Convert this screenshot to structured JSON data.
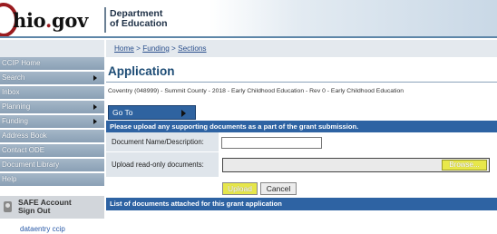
{
  "header": {
    "logo_prefix": "O",
    "logo_main": "hio",
    "logo_dot": ".",
    "logo_suffix": "gov",
    "department_line1": "Department",
    "department_line2": "of Education"
  },
  "breadcrumb": {
    "home": "Home",
    "sep1": " > ",
    "funding": "Funding",
    "sep2": " > ",
    "sections": "Sections"
  },
  "sidebar": {
    "items": [
      {
        "label": "CCIP Home",
        "has_arrow": false
      },
      {
        "label": "Search",
        "has_arrow": true
      },
      {
        "label": "Inbox",
        "has_arrow": false
      },
      {
        "label": "Planning",
        "has_arrow": true
      },
      {
        "label": "Funding",
        "has_arrow": true
      },
      {
        "label": "Address Book",
        "has_arrow": false
      },
      {
        "label": "Contact ODE",
        "has_arrow": false
      },
      {
        "label": "Document Library",
        "has_arrow": false
      },
      {
        "label": "Help",
        "has_arrow": false
      }
    ],
    "safe_line1": "SAFE Account",
    "safe_line2": "Sign Out",
    "footer_link": "dataentry ccip"
  },
  "main": {
    "title": "Application",
    "subtitle": "Coventry (048999) - Summit County - 2018 - Early Childhood Education - Rev 0 - Early Childhood Education",
    "goto_label": "Go To",
    "upload_section_header": "Please upload any supporting documents as a part of the grant submission.",
    "doc_name_label": "Document Name/Description:",
    "doc_name_value": "",
    "upload_label": "Upload read-only documents:",
    "browse_label": "Browse...",
    "upload_button": "Upload",
    "cancel_button": "Cancel",
    "list_header": "List of documents attached for this grant application"
  },
  "colors": {
    "brand_red": "#9a1b1f",
    "nav_blue": "#2e63a3",
    "highlight_yellow": "#e6e64a"
  }
}
